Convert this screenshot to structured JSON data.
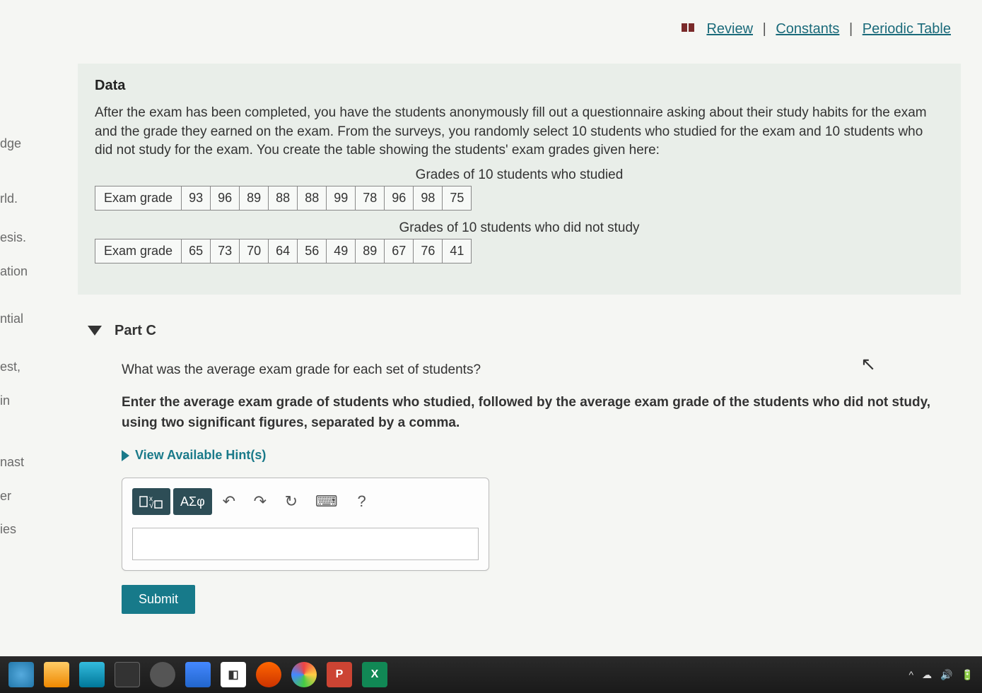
{
  "top_links": {
    "review": "Review",
    "constants": "Constants",
    "periodic": "Periodic Table"
  },
  "sidebar": {
    "items": [
      "dge",
      "rld.",
      "esis.",
      "ation",
      "ntial",
      "est,",
      "in",
      "nast",
      "er",
      "ies"
    ]
  },
  "data_section": {
    "title": "Data",
    "paragraph": "After the exam has been completed, you have the students anonymously fill out a questionnaire asking about their study habits for the exam and the grade they earned on the exam. From the surveys, you randomly select 10 students who studied for the exam and 10 students who did not study for the exam. You create the table showing the students' exam grades given here:",
    "caption1": "Grades of 10 students who studied",
    "row_label": "Exam grade",
    "grades_studied": [
      "93",
      "96",
      "89",
      "88",
      "88",
      "99",
      "78",
      "96",
      "98",
      "75"
    ],
    "caption2": "Grades of 10 students who did not study",
    "grades_not_studied": [
      "65",
      "73",
      "70",
      "64",
      "56",
      "49",
      "89",
      "67",
      "76",
      "41"
    ]
  },
  "part": {
    "label": "Part C",
    "q1": "What was the average exam grade for each set of students?",
    "q2": "Enter the average exam grade of students who studied, followed by the average exam grade of the students who did not study, using two significant figures, separated by a comma.",
    "hints": "View Available Hint(s)",
    "toolbar": {
      "templates": "√",
      "greek": "ΑΣφ",
      "undo": "↶",
      "redo": "↷",
      "reset": "↻",
      "keyboard": "⌨",
      "help": "?"
    },
    "answer_value": "",
    "submit": "Submit"
  },
  "taskbar": {
    "icons": [
      "P",
      "X"
    ],
    "tray": [
      "^",
      "☁",
      "🔊",
      "🔋"
    ]
  }
}
